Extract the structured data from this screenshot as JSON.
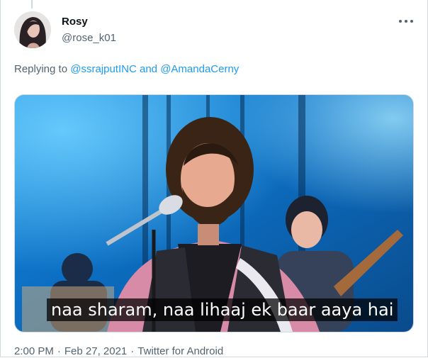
{
  "tweet": {
    "author_name": "Rosy",
    "author_handle": "@rose_k01",
    "reply_prefix": "Replying to",
    "mention_1": "@ssrajputINC",
    "reply_and": "and",
    "mention_2": "@AmandaCerny",
    "media_caption": "naa sharam, naa lihaaj ek baar aaya hai",
    "time": "2:00 PM",
    "date": "Feb 27, 2021",
    "separator": "·",
    "source": "Twitter for Android"
  },
  "icons": {
    "more": "more-dots-icon"
  },
  "colors": {
    "link": "#1d9bf0",
    "secondary_text": "#536471",
    "primary_text": "#0f1419",
    "border": "#cfd9de"
  }
}
